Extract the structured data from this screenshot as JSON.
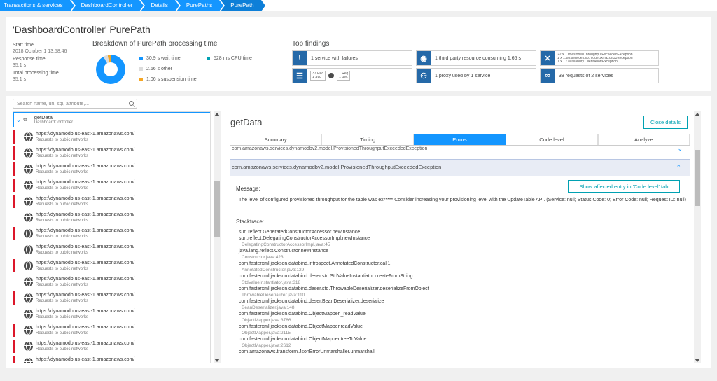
{
  "breadcrumbs": [
    "Transactions & services",
    "DashboardController",
    "Details",
    "PurePaths",
    "PurePath"
  ],
  "header": {
    "title": "'DashboardController' PurePath",
    "start_label": "Start time",
    "start_value": "2018 October 1 13:58:46",
    "response_label": "Response time",
    "response_value": "35.1 s",
    "total_label": "Total processing time",
    "total_value": "35.1 s"
  },
  "breakdown": {
    "title": "Breakdown of PurePath processing time",
    "items": [
      {
        "label": "30.9 s wait time",
        "color": "#1496ff"
      },
      {
        "label": "2.66 s other",
        "color": "#dcdcdc"
      },
      {
        "label": "1.06 s suspension time",
        "color": "#f5a623"
      },
      {
        "label": "528 ms CPU time",
        "color": "#00a1b2"
      }
    ]
  },
  "findings": {
    "title": "Top findings",
    "failures": "1 service with failures",
    "third_party": "1 third party resource consuming 1.65 s",
    "exceptions": [
      "22 x ...rovisionedThroughputExceededException",
      "1 x ...ws.services.s3.model.AmazonS3Exception",
      "1 x ...t.availability.ClientAbortException"
    ],
    "req_a": [
      "37 Req",
      "1 Svc"
    ],
    "req_b": [
      "1 Req",
      "1 Svc"
    ],
    "proxy": "1 proxy used by 1 service",
    "requests": "38 requests of 2 services"
  },
  "search": {
    "placeholder": "Search name, url, sql, attribute,..."
  },
  "tree": {
    "root_title": "getData",
    "root_subtitle": "DashboardController",
    "rows": [
      {
        "url": "https://dynamodb.us-east-1.amazonaws.com/",
        "sub": "Requests to public networks",
        "error": true
      },
      {
        "url": "https://dynamodb.us-east-1.amazonaws.com/",
        "sub": "Requests to public networks",
        "error": true
      },
      {
        "url": "https://dynamodb.us-east-1.amazonaws.com/",
        "sub": "Requests to public networks",
        "error": true
      },
      {
        "url": "https://dynamodb.us-east-1.amazonaws.com/",
        "sub": "Requests to public networks",
        "error": true
      },
      {
        "url": "https://dynamodb.us-east-1.amazonaws.com/",
        "sub": "Requests to public networks",
        "error": true
      },
      {
        "url": "https://dynamodb.us-east-1.amazonaws.com/",
        "sub": "Requests to public networks",
        "error": false
      },
      {
        "url": "https://dynamodb.us-east-1.amazonaws.com/",
        "sub": "Requests to public networks",
        "error": true
      },
      {
        "url": "https://dynamodb.us-east-1.amazonaws.com/",
        "sub": "Requests to public networks",
        "error": false
      },
      {
        "url": "https://dynamodb.us-east-1.amazonaws.com/",
        "sub": "Requests to public networks",
        "error": true
      },
      {
        "url": "https://dynamodb.us-east-1.amazonaws.com/",
        "sub": "Requests to public networks",
        "error": false
      },
      {
        "url": "https://dynamodb.us-east-1.amazonaws.com/",
        "sub": "Requests to public networks",
        "error": true
      },
      {
        "url": "https://dynamodb.us-east-1.amazonaws.com/",
        "sub": "Requests to public networks",
        "error": false
      },
      {
        "url": "https://dynamodb.us-east-1.amazonaws.com/",
        "sub": "Requests to public networks",
        "error": true
      },
      {
        "url": "https://dynamodb.us-east-1.amazonaws.com/",
        "sub": "Requests to public networks",
        "error": true
      },
      {
        "url": "https://dynamodb.us-east-1.amazonaws.com/",
        "sub": "Requests to public networks",
        "error": true
      }
    ]
  },
  "details": {
    "title": "getData",
    "close_label": "Close details",
    "tabs": [
      "Summary",
      "Timing",
      "Errors",
      "Code level",
      "Analyze"
    ],
    "active_tab": 2,
    "exception_collapsed": "com.amazonaws.services.dynamodbv2.model.ProvisionedThroughputExceededException",
    "exception_open": "com.amazonaws.services.dynamodbv2.model.ProvisionedThroughputExceededException",
    "message_label": "Message:",
    "show_button": "Show affected entry in 'Code level' tab",
    "message": "The level of configured provisioned throughput for the table was ex***** Consider increasing your provisioning level with the UpdateTable API. (Service: null; Status Code: 0; Error Code: null; Request ID: null)",
    "stacktrace_label": "Stacktrace:",
    "stack": [
      {
        "fn": "sun.reflect.GeneratedConstructorAccessor.newInstance",
        "loc": ""
      },
      {
        "fn": "sun.reflect.DelegatingConstructorAccessorImpl.newInstance",
        "loc": "DelegatingConstructorAccessorImpl.java:45"
      },
      {
        "fn": "java.lang.reflect.Constructor.newInstance",
        "loc": "Constructor.java:423"
      },
      {
        "fn": "com.fasterxml.jackson.databind.introspect.AnnotatedConstructor.call1",
        "loc": "AnnotatedConstructor.java:129"
      },
      {
        "fn": "com.fasterxml.jackson.databind.deser.std.StdValueInstantiator.createFromString",
        "loc": "StdValueInstantiator.java:318"
      },
      {
        "fn": "com.fasterxml.jackson.databind.deser.std.ThrowableDeserializer.deserializeFromObject",
        "loc": "ThrowableDeserializer.java:110"
      },
      {
        "fn": "com.fasterxml.jackson.databind.deser.BeanDeserializer.deserialize",
        "loc": "BeanDeserializer.java:148"
      },
      {
        "fn": "com.fasterxml.jackson.databind.ObjectMapper._readValue",
        "loc": "ObjectMapper.java:3786"
      },
      {
        "fn": "com.fasterxml.jackson.databind.ObjectMapper.readValue",
        "loc": "ObjectMapper.java:2115"
      },
      {
        "fn": "com.fasterxml.jackson.databind.ObjectMapper.treeToValue",
        "loc": "ObjectMapper.java:2612"
      },
      {
        "fn": "com.amazonaws.transform.JsonErrorUnmarshaller.unmarshall",
        "loc": ""
      }
    ]
  }
}
